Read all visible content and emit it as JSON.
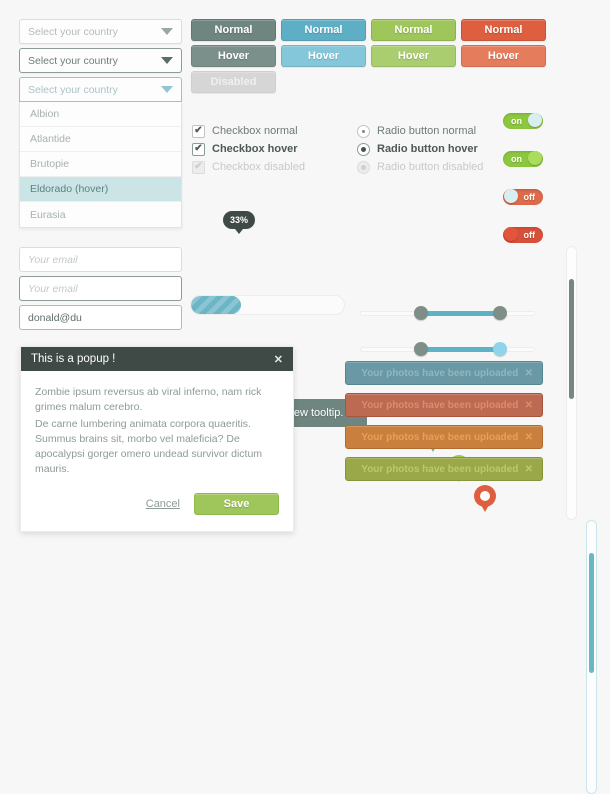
{
  "selects": {
    "placeholder": "Select your country",
    "states": [
      "normal",
      "hover",
      "focus"
    ],
    "options": [
      "Albion",
      "Atlantide",
      "Brutopie",
      "Eldorado (hover)",
      "Eurasia"
    ],
    "selected_option": "Eldorado (hover)"
  },
  "email_inputs": {
    "placeholder": "Your email",
    "focused_value": "donald@du"
  },
  "buttons": {
    "normal_label": "Normal",
    "hover_label": "Hover",
    "disabled_label": "Disabled",
    "colors": {
      "gray_normal": "#6f857f",
      "gray_hover": "#7b908a",
      "blue_normal": "#5eafc6",
      "blue_hover": "#85c7da",
      "green_normal": "#9fc65a",
      "green_hover": "#aacd6f",
      "red_normal": "#dd5f3f",
      "red_hover": "#e57c5c",
      "disabled": "#d6d6d6"
    }
  },
  "checkboxes": [
    {
      "label": "Checkbox normal",
      "state": "normal",
      "checked": true,
      "mark": "✔"
    },
    {
      "label": "Checkbox hover",
      "state": "hover",
      "checked": true,
      "mark": "✔"
    },
    {
      "label": "Checkbox disabled",
      "state": "disabled",
      "checked": true,
      "mark": "✔"
    }
  ],
  "radios": [
    {
      "label": "Radio button normal",
      "state": "normal"
    },
    {
      "label": "Radio button hover",
      "state": "hover"
    },
    {
      "label": "Radio button disabled",
      "state": "disabled"
    }
  ],
  "toggles": [
    {
      "label": "on",
      "state": "on",
      "color": "#8dc63f"
    },
    {
      "label": "on",
      "state": "on",
      "color": "#8dc63f"
    },
    {
      "label": "off",
      "state": "off",
      "color": "#dd6a4a"
    },
    {
      "label": "off",
      "state": "off",
      "color": "#d9503a"
    }
  ],
  "progress": {
    "value_label": "33%",
    "percent": 33,
    "fill_color": "#6cb5c4"
  },
  "sliders": [
    {
      "left_percent": 35,
      "right_percent": 80,
      "right_handle_state": "normal"
    },
    {
      "left_percent": 35,
      "right_percent": 80,
      "right_handle_state": "active"
    }
  ],
  "tooltip": {
    "text": "Heya ! I am your new tooltip.",
    "color": "#6f857f"
  },
  "pins": [
    {
      "color": "#5eafc6",
      "name": "map-pin-blue"
    },
    {
      "color": "#9fc65a",
      "name": "map-pin-green"
    },
    {
      "color": "#dd5f3f",
      "name": "map-pin-orange"
    }
  ],
  "popup": {
    "title": "This is a popup !",
    "close_label": "✕",
    "paragraphs": [
      "Zombie ipsum reversus ab viral inferno, nam rick grimes malum cerebro.",
      "De carne lumbering animata corpora quaeritis. Summus brains sit, morbo vel maleficia? De apocalypsi gorger omero undead survivor dictum mauris."
    ],
    "cancel_label": "Cancel",
    "save_label": "Save"
  },
  "alerts": [
    {
      "text": "Your photos have been uploaded",
      "close_label": "✕",
      "bg": "#6a98a4",
      "border": "#558894",
      "fg": "#8fb7c0"
    },
    {
      "text": "Your photos have been uploaded",
      "close_label": "✕",
      "bg": "#bd6a52",
      "border": "#a85440",
      "fg": "#e08a6c"
    },
    {
      "text": "Your photos have been uploaded",
      "close_label": "✕",
      "bg": "#c97f3e",
      "border": "#b36c2e",
      "fg": "#e8a055"
    },
    {
      "text": "Your photos have been uploaded",
      "close_label": "✕",
      "bg": "#9aa84a",
      "border": "#87953a",
      "fg": "#bcc96a"
    }
  ],
  "scrollbars": [
    {
      "thumb_color": "#77867f",
      "track_color": "#fdfdfd"
    },
    {
      "thumb_color": "#6cb5c4",
      "track_color": "#fdfdfd"
    }
  ]
}
